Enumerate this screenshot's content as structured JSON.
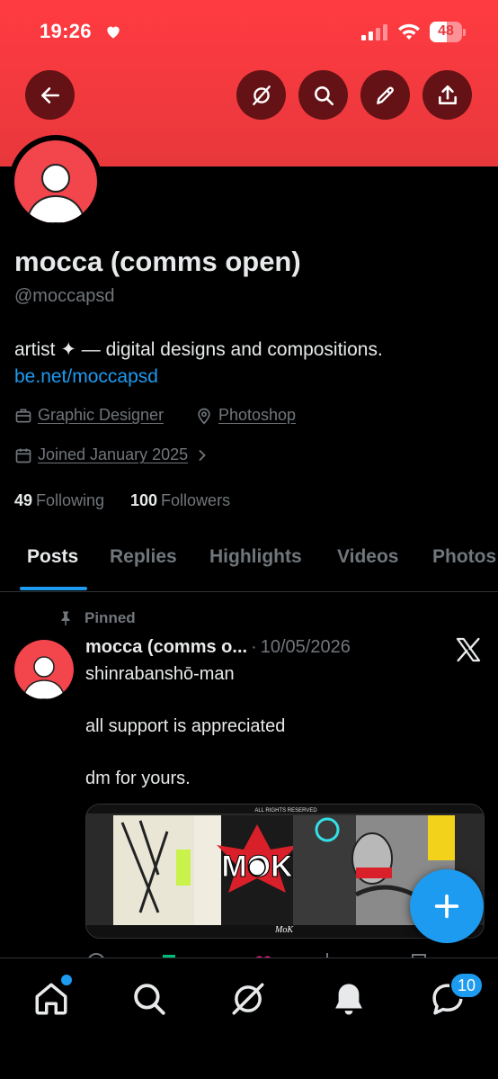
{
  "status_bar": {
    "time": "19:26",
    "battery": "48"
  },
  "profile": {
    "name": "mocca (comms open)",
    "handle": "@moccapsd",
    "bio": "artist ✦ — digital designs and compositions.",
    "link": "be.net/moccapsd",
    "category": "Graphic Designer",
    "location": "Photoshop",
    "joined": "Joined January 2025",
    "following_count": "49",
    "following_label": "Following",
    "followers_count": "100",
    "followers_label": "Followers"
  },
  "tabs": [
    {
      "label": "Posts",
      "active": true
    },
    {
      "label": "Replies",
      "active": false
    },
    {
      "label": "Highlights",
      "active": false
    },
    {
      "label": "Videos",
      "active": false
    },
    {
      "label": "Photos",
      "active": false
    }
  ],
  "pinned_post": {
    "pinned_label": "Pinned",
    "author": "mocca (comms o...",
    "separator": "·",
    "date": "10/05/2026",
    "lines": [
      "shinrabanshō-man",
      "all support is appreciated",
      "dm for yours."
    ],
    "media_caption": "ALL RIGHTS RESERVED"
  },
  "bottom_nav": {
    "messages_badge": "10"
  },
  "colors": {
    "banner": "#e8383c",
    "accent": "#1d9bf0",
    "text_primary": "#e7e9ea",
    "text_secondary": "#71767b",
    "background": "#000000"
  },
  "icons": {
    "header": [
      "back-arrow-icon",
      "grok-icon",
      "search-icon",
      "pencil-icon",
      "share-icon"
    ],
    "nav": [
      "home-icon",
      "search-icon",
      "grok-icon",
      "notifications-icon",
      "messages-icon"
    ]
  }
}
